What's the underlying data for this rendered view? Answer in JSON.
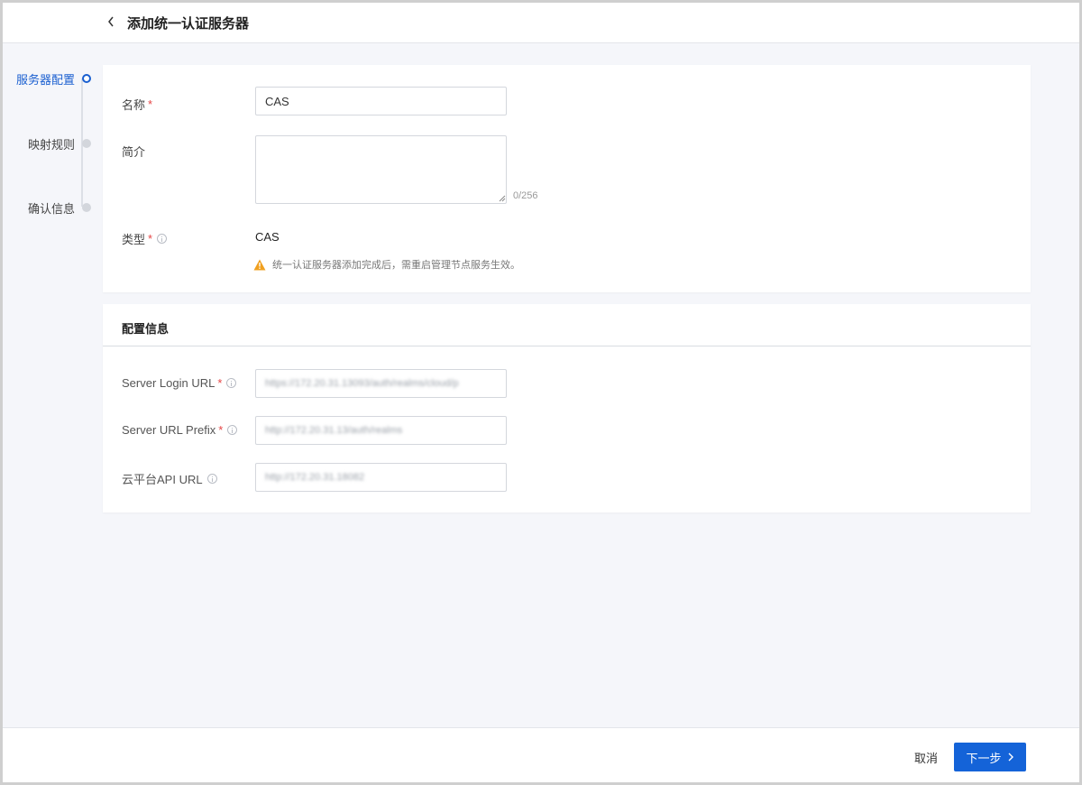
{
  "header": {
    "title": "添加统一认证服务器"
  },
  "stepper": {
    "steps": [
      {
        "label": "服务器配置"
      },
      {
        "label": "映射规则"
      },
      {
        "label": "确认信息"
      }
    ]
  },
  "basic": {
    "name_label": "名称",
    "name_value": "CAS",
    "desc_label": "简介",
    "desc_counter": "0/256",
    "type_label": "类型",
    "type_value": "CAS",
    "notice": "统一认证服务器添加完成后，需重启管理节点服务生效。"
  },
  "config": {
    "title": "配置信息",
    "login_url_label": "Server Login URL",
    "login_url_value": "https://172.20.31.13093/auth/realms/cloud/p",
    "prefix_label": "Server URL Prefix",
    "prefix_value": "http://172.20.31.13/auth/realms",
    "api_url_label": "云平台API URL",
    "api_url_value": "http://172.20.31.18082"
  },
  "footer": {
    "cancel_label": "取消",
    "next_label": "下一步"
  },
  "colors": {
    "primary": "#1463d8",
    "required": "#e54545",
    "warning": "#f0a020"
  }
}
